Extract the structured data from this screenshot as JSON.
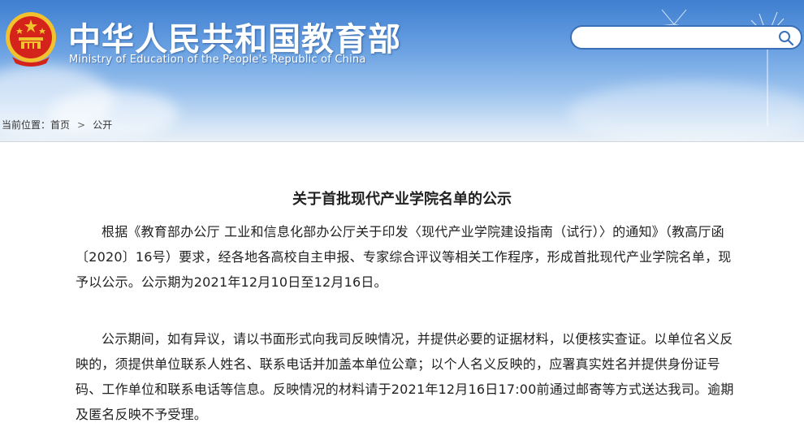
{
  "header": {
    "title_cn": "中华人民共和国教育部",
    "title_en": "Ministry of Education of the People's Republic of China"
  },
  "search": {
    "placeholder": ""
  },
  "breadcrumb": {
    "label": "当前位置：",
    "items": [
      "首页",
      "公开"
    ],
    "separator": ">"
  },
  "article": {
    "title": "关于首批现代产业学院名单的公示",
    "paragraphs": [
      "根据《教育部办公厅 工业和信息化部办公厅关于印发〈现代产业学院建设指南（试行）〉的通知》（教高厅函〔2020〕16号）要求，经各地各高校自主申报、专家综合评议等相关工作程序，形成首批现代产业学院名单，现予以公示。公示期为2021年12月10日至12月16日。",
      "公示期间，如有异议，请以书面形式向我司反映情况，并提供必要的证据材料，以便核实查证。以单位名义反映的，须提供单位联系人姓名、联系电话并加盖本单位公章；以个人名义反映的，应署真实姓名并提供身份证号码、工作单位和联系电话等信息。反映情况的材料请于2021年12月16日17:00前通过邮寄等方式送达我司。逾期及匿名反映不予受理。"
    ]
  },
  "colors": {
    "header_top": "#3f7fd0",
    "search_border": "#3b6fb8",
    "emblem_red": "#d4231b",
    "emblem_gold": "#f2c12e"
  }
}
